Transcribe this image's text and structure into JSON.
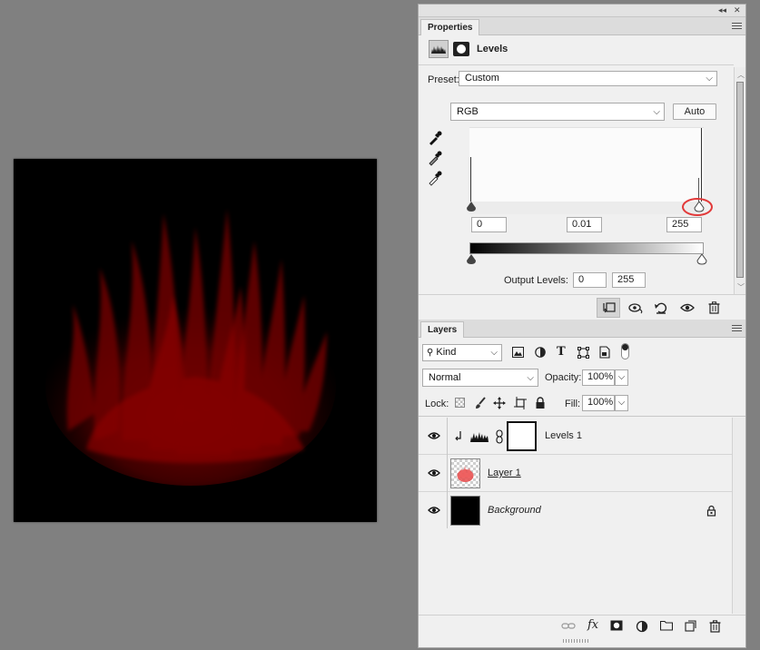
{
  "properties_panel": {
    "tab_label": "Properties",
    "adjustment_title": "Levels",
    "preset_label": "Preset:",
    "preset_value": "Custom",
    "channel_value": "RGB",
    "auto_label": "Auto",
    "input_black": "0",
    "input_gamma": "0.01",
    "input_white": "255",
    "output_label": "Output Levels:",
    "output_black": "0",
    "output_white": "255"
  },
  "layers_panel": {
    "tab_label": "Layers",
    "kind_label": "Kind",
    "blend_mode": "Normal",
    "opacity_label": "Opacity:",
    "opacity_value": "100%",
    "lock_label": "Lock:",
    "fill_label": "Fill:",
    "fill_value": "100%",
    "layers": [
      {
        "name": "Levels 1"
      },
      {
        "name": "Layer 1"
      },
      {
        "name": "Background"
      }
    ]
  },
  "colors": {
    "selection": "#b3cce9",
    "highlight_ring": "#e23a3a",
    "flame": "#7a0000"
  },
  "icons": {
    "adjustment": "levels-histogram-icon",
    "mask": "layer-mask-icon",
    "lock": "lock-icon",
    "visibility": "eye-icon"
  }
}
